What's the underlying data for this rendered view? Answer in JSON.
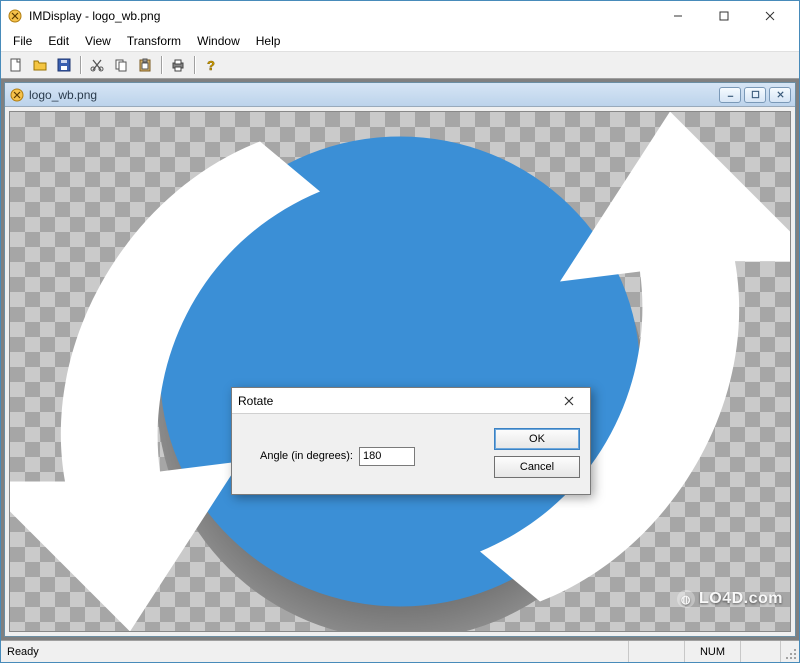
{
  "window": {
    "title": "IMDisplay - logo_wb.png"
  },
  "menu": {
    "file": "File",
    "edit": "Edit",
    "view": "View",
    "transform": "Transform",
    "window": "Window",
    "help": "Help"
  },
  "toolbar_icons": {
    "new": "new-file-icon",
    "open": "open-folder-icon",
    "save": "save-disk-icon",
    "cut": "cut-scissors-icon",
    "copy": "copy-icon",
    "paste": "paste-clipboard-icon",
    "print": "print-icon",
    "help": "help-question-icon"
  },
  "child_window": {
    "title": "logo_wb.png"
  },
  "dialog": {
    "title": "Rotate",
    "label": "Angle (in degrees):",
    "value": "180",
    "ok": "OK",
    "cancel": "Cancel"
  },
  "statusbar": {
    "ready": "Ready",
    "num": "NUM"
  },
  "watermark": {
    "text": "LO4D.com"
  },
  "colors": {
    "accent": "#3b8fd6",
    "checker_dark": "#a6a6a6",
    "checker_light": "#cacaca",
    "window_border": "#488bba"
  }
}
